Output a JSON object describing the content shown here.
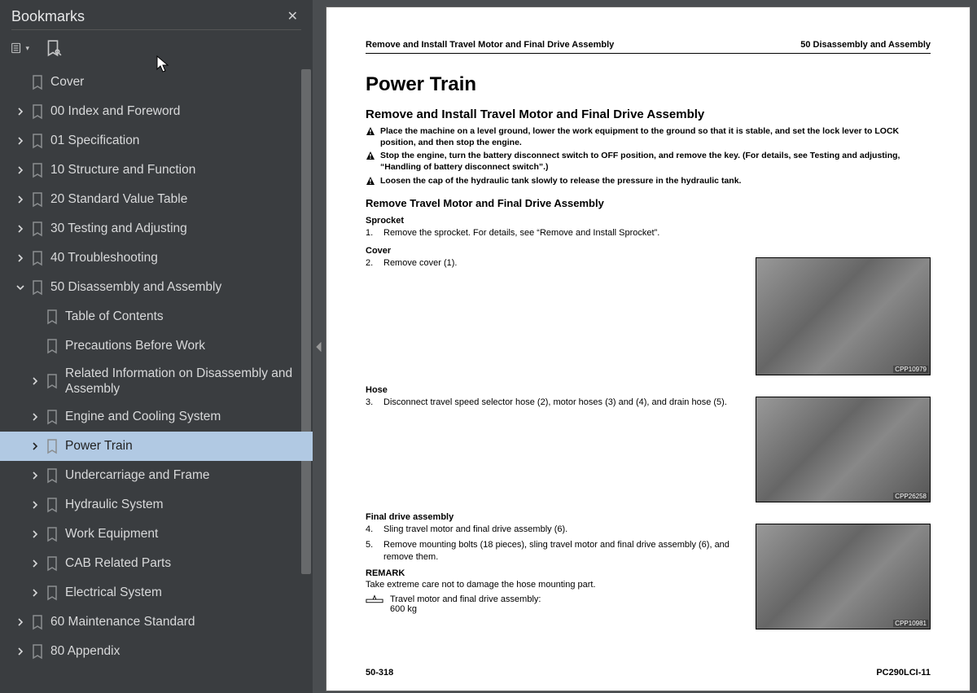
{
  "sidebar": {
    "title": "Bookmarks",
    "items": [
      {
        "label": "Cover",
        "lvl": 0,
        "chev": "none"
      },
      {
        "label": "00 Index and Foreword",
        "lvl": 0,
        "chev": "right"
      },
      {
        "label": "01 Specification",
        "lvl": 0,
        "chev": "right"
      },
      {
        "label": "10 Structure and Function",
        "lvl": 0,
        "chev": "right"
      },
      {
        "label": "20 Standard Value Table",
        "lvl": 0,
        "chev": "right"
      },
      {
        "label": "30 Testing and Adjusting",
        "lvl": 0,
        "chev": "right"
      },
      {
        "label": "40 Troubleshooting",
        "lvl": 0,
        "chev": "right"
      },
      {
        "label": "50 Disassembly and Assembly",
        "lvl": 0,
        "chev": "down"
      },
      {
        "label": "Table of Contents",
        "lvl": 1,
        "chev": "none"
      },
      {
        "label": "Precautions Before Work",
        "lvl": 1,
        "chev": "none"
      },
      {
        "label": "Related Information on Disassembly and Assembly",
        "lvl": 1,
        "chev": "right"
      },
      {
        "label": "Engine and Cooling System",
        "lvl": 1,
        "chev": "right"
      },
      {
        "label": "Power Train",
        "lvl": 1,
        "chev": "right",
        "selected": true
      },
      {
        "label": "Undercarriage and Frame",
        "lvl": 1,
        "chev": "right"
      },
      {
        "label": "Hydraulic System",
        "lvl": 1,
        "chev": "right"
      },
      {
        "label": "Work Equipment",
        "lvl": 1,
        "chev": "right"
      },
      {
        "label": "CAB Related Parts",
        "lvl": 1,
        "chev": "right"
      },
      {
        "label": "Electrical System",
        "lvl": 1,
        "chev": "right"
      },
      {
        "label": "60 Maintenance Standard",
        "lvl": 0,
        "chev": "right"
      },
      {
        "label": "80 Appendix",
        "lvl": 0,
        "chev": "right"
      }
    ]
  },
  "doc": {
    "header_left": "Remove and Install Travel Motor and Final Drive Assembly",
    "header_right": "50 Disassembly and Assembly",
    "h1": "Power Train",
    "h2": "Remove and Install Travel Motor and Final Drive Assembly",
    "warns": [
      "Place the machine on a level ground, lower the work equipment to the ground so that it is stable, and set the lock lever to LOCK position, and then stop the engine.",
      "Stop the engine, turn the battery disconnect switch to OFF position, and remove the key. (For details, see Testing and adjusting, “Handling of battery disconnect switch”.)",
      "Loosen the cap of the hydraulic tank slowly to release the pressure in the hydraulic tank."
    ],
    "h3": "Remove Travel Motor and Final Drive Assembly",
    "sub1": "Sprocket",
    "step1_n": "1.",
    "step1_t": "Remove the sprocket. For details, see “Remove and Install Sprocket”.",
    "sub2": "Cover",
    "step2_n": "2.",
    "step2_t": "Remove cover (1).",
    "fig1": "CPP10979",
    "sub3": "Hose",
    "step3_n": "3.",
    "step3_t": "Disconnect travel speed selector hose (2), motor hoses (3) and (4), and drain hose (5).",
    "fig2": "CPP26258",
    "sub4": "Final drive assembly",
    "step4_n": "4.",
    "step4_t": "Sling travel motor and final drive assembly (6).",
    "step5_n": "5.",
    "step5_t": "Remove mounting bolts (18 pieces), sling travel motor and final drive assembly (6), and remove them.",
    "remark_label": "REMARK",
    "remark_text": "Take extreme care not to damage the hose mounting part.",
    "mass_label": "Travel motor and final drive assembly:",
    "mass_value": "600 kg",
    "fig3": "CPP10981",
    "footer_left": "50-318",
    "footer_right": "PC290LCI-11"
  }
}
